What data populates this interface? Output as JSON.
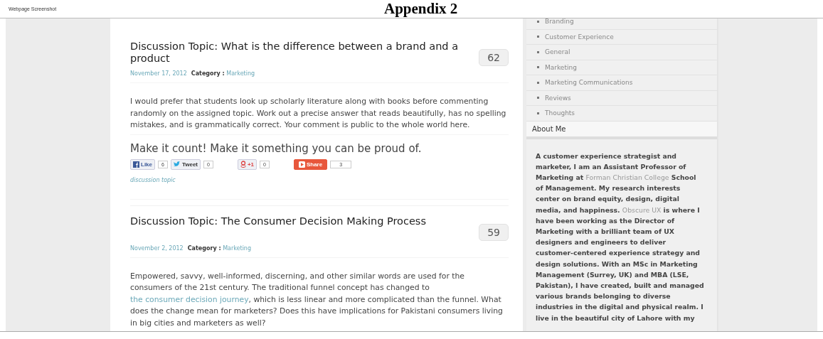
{
  "document": {
    "caption": "Webpage Screenshot",
    "heading": "Appendix 2"
  },
  "posts": [
    {
      "title": "Discussion Topic: What is the difference between a brand and a product",
      "comment_count": "62",
      "date": "November 17, 2012",
      "category_label": "Category :",
      "category": "Marketing",
      "body": [
        {
          "text": "I would prefer that students look up scholarly literature along with books before commenting randomly on the assigned topic. Work out a precise answer that reads beautifully, has no spelling mistakes, and is grammatically correct. Your comment is public to the whole world here."
        }
      ],
      "callout": "Make it count! Make it something you can be proud of.",
      "share_buttons": [
        {
          "kind": "facebook",
          "label": "Like",
          "count": "6"
        },
        {
          "kind": "twitter",
          "label": "Tweet",
          "count": "0"
        },
        {
          "kind": "google",
          "label": "+1",
          "count": "0"
        },
        {
          "kind": "share",
          "label": "Share",
          "count": "3"
        }
      ],
      "tag": "discussion topic"
    },
    {
      "title": "Discussion Topic: The Consumer Decision Making Process",
      "comment_count": "59",
      "date": "November 2, 2012",
      "category_label": "Category :",
      "category": "Marketing",
      "body": [
        {
          "text": "Empowered, savvy, well-informed, discerning, and other similar words are used for the consumers of the 21st century. The traditional funnel concept has changed to "
        },
        {
          "text": "the consumer decision journey",
          "link": true
        },
        {
          "text": ", which is less linear and more complicated than the funnel. What does the change mean for marketers? Does this have implications for Pakistani consumers living in big cities and marketers as well?"
        }
      ]
    }
  ],
  "sidebar": {
    "categories": [
      "Branding",
      "Customer Experience",
      "General",
      "Marketing",
      "Marketing Communications",
      "Reviews",
      "Thoughts"
    ],
    "about_title": "About Me",
    "about_text": [
      {
        "text": "A customer experience strategist and marketer, I am an Assistant Professor of Marketing at "
      },
      {
        "text": "Forman Christian College",
        "link": true
      },
      {
        "text": " School of Management. My research interests center on brand equity, design, digital media, and happiness. "
      },
      {
        "text": "Obscure UX",
        "link": true
      },
      {
        "text": " is where I have been working as the Director of Marketing with a brilliant team of UX designers and engineers to deliver customer-centered experience strategy and design solutions. With an MSc in Marketing Management (Surrey, UK) and MBA (LSE, Pakistan), I have created, built and managed various brands belonging to diverse industries in the digital and physical realm. I live in the beautiful city of Lahore with my"
      }
    ]
  }
}
